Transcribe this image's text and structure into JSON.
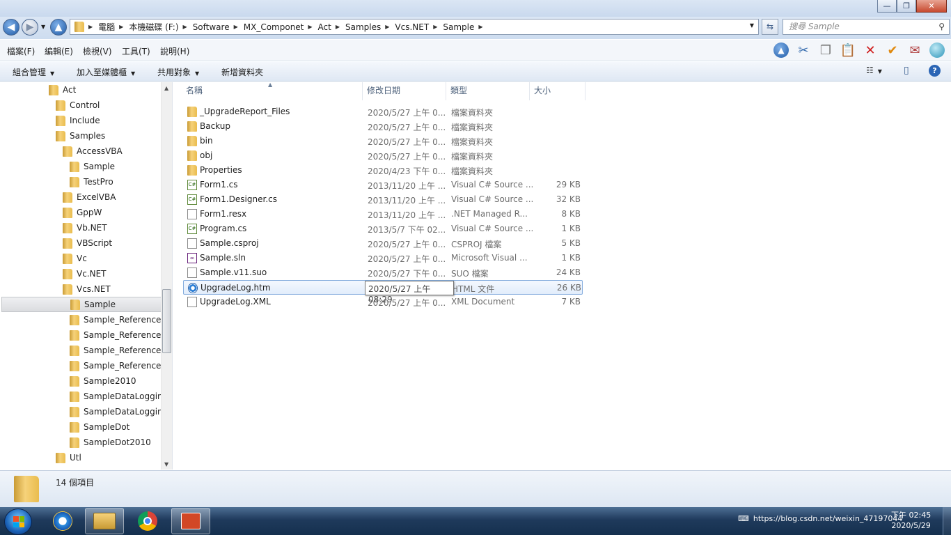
{
  "window": {
    "controls": {
      "minimize": "—",
      "maximize": "❐",
      "close": "✕"
    }
  },
  "navigation": {
    "breadcrumb": [
      "電腦",
      "本機磁碟 (F:)",
      "Software",
      "MX_Componet",
      "Act",
      "Samples",
      "Vcs.NET",
      "Sample"
    ],
    "search_placeholder": "搜尋 Sample"
  },
  "menu": [
    "檔案(F)",
    "編輯(E)",
    "檢視(V)",
    "工具(T)",
    "說明(H)"
  ],
  "commands": [
    "組合管理",
    "加入至媒體櫃",
    "共用對象",
    "新增資料夾"
  ],
  "tree": [
    {
      "label": "Act",
      "level": 0
    },
    {
      "label": "Control",
      "level": 1
    },
    {
      "label": "Include",
      "level": 1
    },
    {
      "label": "Samples",
      "level": 1
    },
    {
      "label": "AccessVBA",
      "level": 2
    },
    {
      "label": "Sample",
      "level": 3
    },
    {
      "label": "TestPro",
      "level": 3
    },
    {
      "label": "ExcelVBA",
      "level": 2
    },
    {
      "label": "GppW",
      "level": 2
    },
    {
      "label": "Vb.NET",
      "level": 2
    },
    {
      "label": "VBScript",
      "level": 2
    },
    {
      "label": "Vc",
      "level": 2
    },
    {
      "label": "Vc.NET",
      "level": 2
    },
    {
      "label": "Vcs.NET",
      "level": 2
    },
    {
      "label": "Sample",
      "level": 3,
      "selected": true
    },
    {
      "label": "Sample_References",
      "level": 3
    },
    {
      "label": "Sample_References",
      "level": 3
    },
    {
      "label": "Sample_References",
      "level": 3
    },
    {
      "label": "Sample_References",
      "level": 3
    },
    {
      "label": "Sample2010",
      "level": 3
    },
    {
      "label": "SampleDataLoggin",
      "level": 3
    },
    {
      "label": "SampleDataLoggin",
      "level": 3
    },
    {
      "label": "SampleDot",
      "level": 3
    },
    {
      "label": "SampleDot2010",
      "level": 3
    },
    {
      "label": "Utl",
      "level": 1
    }
  ],
  "columns": {
    "name": "名稱",
    "date": "修改日期",
    "type": "類型",
    "size": "大小"
  },
  "files": [
    {
      "name": "_UpgradeReport_Files",
      "date": "2020/5/27 上午 0...",
      "type": "檔案資料夾",
      "size": "",
      "icon": "folder-icon"
    },
    {
      "name": "Backup",
      "date": "2020/5/27 上午 0...",
      "type": "檔案資料夾",
      "size": "",
      "icon": "folder-icon"
    },
    {
      "name": "bin",
      "date": "2020/5/27 上午 0...",
      "type": "檔案資料夾",
      "size": "",
      "icon": "folder-icon"
    },
    {
      "name": "obj",
      "date": "2020/5/27 上午 0...",
      "type": "檔案資料夾",
      "size": "",
      "icon": "folder-icon"
    },
    {
      "name": "Properties",
      "date": "2020/4/23 下午 0...",
      "type": "檔案資料夾",
      "size": "",
      "icon": "folder-icon"
    },
    {
      "name": "Form1.cs",
      "date": "2013/11/20 上午 ...",
      "type": "Visual C# Source ...",
      "size": "29 KB",
      "icon": "csharp-file-icon"
    },
    {
      "name": "Form1.Designer.cs",
      "date": "2013/11/20 上午 ...",
      "type": "Visual C# Source ...",
      "size": "32 KB",
      "icon": "csharp-file-icon"
    },
    {
      "name": "Form1.resx",
      "date": "2013/11/20 上午 ...",
      "type": ".NET Managed R...",
      "size": "8 KB",
      "icon": "resx-file-icon"
    },
    {
      "name": "Program.cs",
      "date": "2013/5/7 下午 02...",
      "type": "Visual C# Source ...",
      "size": "1 KB",
      "icon": "csharp-file-icon"
    },
    {
      "name": "Sample.csproj",
      "date": "2020/5/27 上午 0...",
      "type": "CSPROJ 檔案",
      "size": "5 KB",
      "icon": "project-file-icon"
    },
    {
      "name": "Sample.sln",
      "date": "2020/5/27 上午 0...",
      "type": "Microsoft Visual ...",
      "size": "1 KB",
      "icon": "solution-file-icon"
    },
    {
      "name": "Sample.v11.suo",
      "date": "2020/5/27 下午 0...",
      "type": "SUO 檔案",
      "size": "24 KB",
      "icon": "suo-file-icon"
    },
    {
      "name": "UpgradeLog.htm",
      "date": "2020/5/27 上午 0...",
      "type": "HTML 文件",
      "size": "26 KB",
      "icon": "html-file-icon",
      "selected": true
    },
    {
      "name": "UpgradeLog.XML",
      "date": "2020/5/27 上午 0...",
      "type": "XML Document",
      "size": "7 KB",
      "icon": "xml-file-icon"
    }
  ],
  "tooltip": "2020/5/27 上午 08:29",
  "details": {
    "item_count": "14 個項目"
  },
  "taskbar": {
    "tray_url": "https://blog.csdn.net/weixin_47197044",
    "time": "下午 02:45",
    "date": "2020/5/29"
  }
}
